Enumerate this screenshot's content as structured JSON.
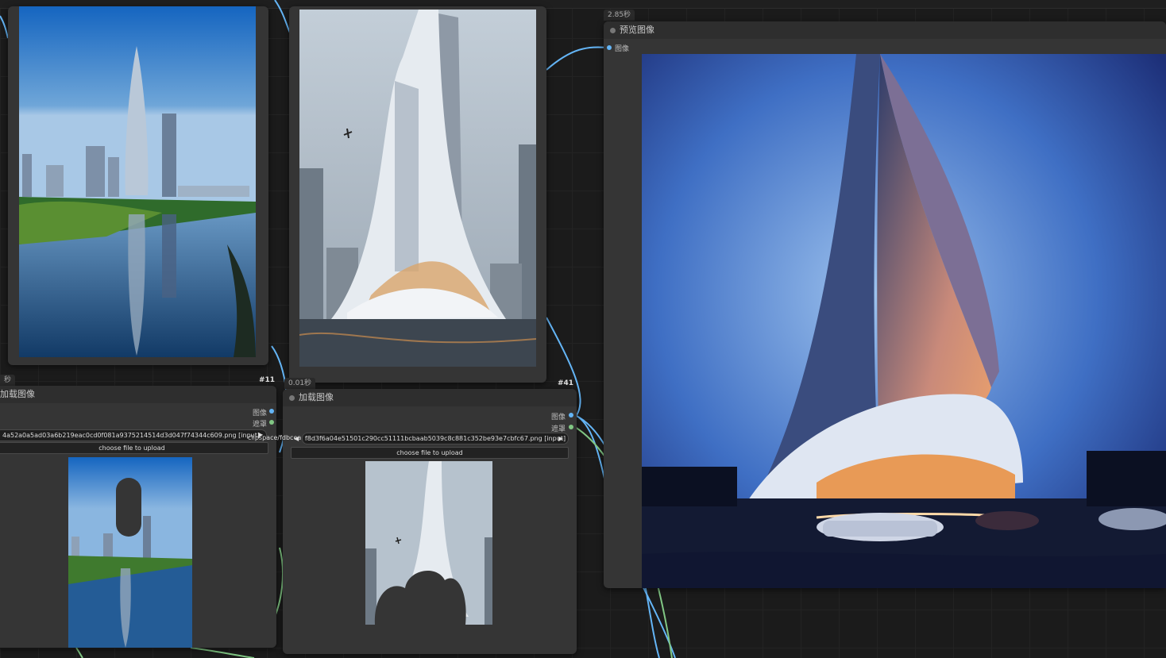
{
  "nodes": {
    "left_load": {
      "timing": "秒",
      "id": "#11",
      "title": "加载图像",
      "outputs": [
        "图像",
        "遮罩"
      ],
      "filename": "4a52a0a5ad03a6b219eac0cd0f081a9375214514d3d047f74344c609.png [input]",
      "upload_label": "choose file to upload"
    },
    "mid_load": {
      "timing": "0.01秒",
      "id": "#41",
      "title": "加载图像",
      "outputs": [
        "图像",
        "遮罩"
      ],
      "filename_prefix": "clipspace/fdbcea",
      "filename": "f8d3f6a04e51501c290cc51111bcbaab5039c8c881c352be93e7cbfc67.png [input]",
      "upload_label": "choose file to upload"
    },
    "preview": {
      "timing": "2.85秒",
      "title": "预览图像",
      "input": "图像"
    }
  },
  "colors": {
    "image_link": "#64b5f6",
    "mask_link": "#81c784",
    "node_bg": "#353535"
  },
  "icons": {
    "arrow_right": "▶",
    "arrow_left": "◀"
  }
}
